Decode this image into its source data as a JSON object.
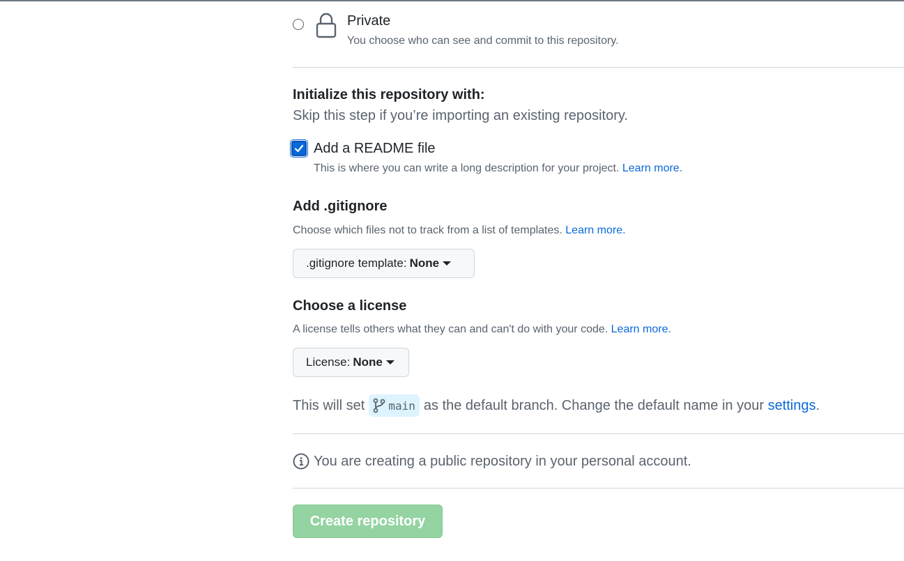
{
  "visibility": {
    "private": {
      "title": "Private",
      "description": "You choose who can see and commit to this repository.",
      "selected": false
    }
  },
  "initialize": {
    "title": "Initialize this repository with:",
    "description": "Skip this step if you’re importing an existing repository.",
    "readme": {
      "label": "Add a README file",
      "checked": true,
      "description": "This is where you can write a long description for your project.",
      "link": "Learn more."
    }
  },
  "gitignore": {
    "title": "Add .gitignore",
    "description": "Choose which files not to track from a list of templates.",
    "link": "Learn more.",
    "button_prefix": ".gitignore template:",
    "button_value": "None"
  },
  "license": {
    "title": "Choose a license",
    "description": "A license tells others what they can and can't do with your code.",
    "link": "Learn more.",
    "button_prefix": "License:",
    "button_value": "None"
  },
  "branch": {
    "prefix": "This will set",
    "name": "main",
    "suffix": "as the default branch. Change the default name in your",
    "link": "settings",
    "end": "."
  },
  "notice": {
    "text": "You are creating a public repository in your personal account."
  },
  "create_button": {
    "label": "Create repository"
  },
  "colors": {
    "accent": "#0969da",
    "create_disabled": "#94d3a2",
    "branch_bg": "#ddf4ff"
  }
}
